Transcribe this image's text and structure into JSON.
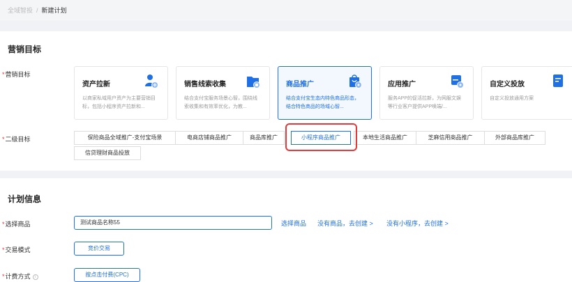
{
  "breadcrumb": {
    "parent": "全域智投",
    "separator": "/",
    "current": "新建计划"
  },
  "marketing": {
    "section_title": "营销目标",
    "goal_label": "营销目标",
    "goals": [
      {
        "title": "资产拉新",
        "desc": "以商家私域用户资产为主要营销目标，包括小程序资产拉新和...",
        "icon": "users-add-icon"
      },
      {
        "title": "销售线索收集",
        "desc": "结合支付宝服务场景心智，围绕线索收集和有效率优化，为教...",
        "icon": "folder-icon"
      },
      {
        "title": "商品推广",
        "desc": "结合支付宝生态内特色商品形态，结合特色商品的场域心智...",
        "icon": "shopping-bag-icon"
      },
      {
        "title": "应用推广",
        "desc": "服务APP的促活拉新，为网服文娱等行业客户提供APP唤端/...",
        "icon": "app-icon"
      },
      {
        "title": "自定义投放",
        "desc": "自定义投放通用方案",
        "icon": "document-icon"
      }
    ],
    "secondary_label": "二级目标",
    "secondary_options": [
      "保险商品全域推广-支付宝场景",
      "电商店铺商品推广",
      "商品库推广",
      "小程序商品推广",
      "本地生活商品推广",
      "芝麻信用商品推广",
      "外部商品库推广",
      "信贷理财商品投放"
    ],
    "selected_secondary": "小程序商品推广",
    "accent_color": "#1f6fe5",
    "highlight_color": "#e5383b"
  },
  "plan": {
    "section_title": "计划信息",
    "product_label": "选择商品",
    "product_value": "测试商品名称55",
    "select_product_link": "选择商品",
    "no_product_link": "没有商品，去创建 >",
    "no_miniapp_link": "没有小程序，去创建 >",
    "trade_mode_label": "交易模式",
    "trade_mode_value": "竞价交易",
    "billing_label": "计费方式",
    "billing_value": "按点击付费(CPC)",
    "info_icon": "i"
  }
}
